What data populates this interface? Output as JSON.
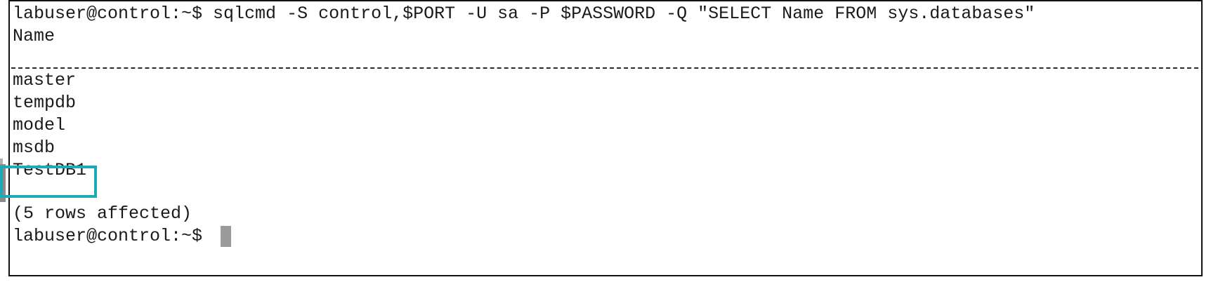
{
  "terminal": {
    "command_line": "labuser@control:~$ sqlcmd -S control,$PORT -U sa -P $PASSWORD -Q \"SELECT Name FROM sys.databases\"",
    "column_header": "Name",
    "separator": "--------------------------------------------------------------------------------------------------------------------------------------------",
    "rows": [
      "master",
      "tempdb",
      "model",
      "msdb",
      "TestDB1"
    ],
    "rows_affected": "(5 rows affected)",
    "prompt": "labuser@control:~$ "
  },
  "colors": {
    "highlight_border": "#1eaab2",
    "cursor": "#9a9a9a",
    "text": "#1a1a1a"
  }
}
